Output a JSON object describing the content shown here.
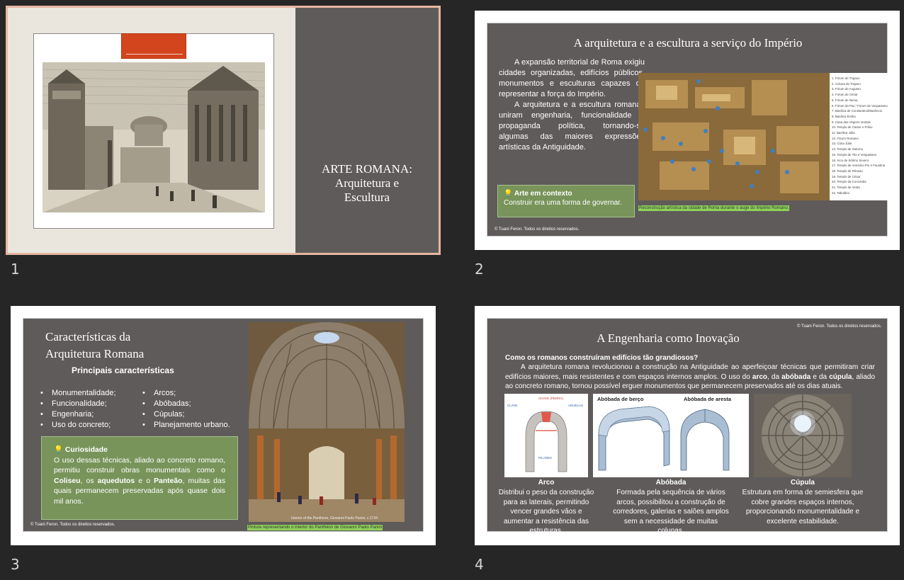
{
  "slide_numbers": [
    "1",
    "2",
    "3",
    "4"
  ],
  "slide1": {
    "title_line1": "ARTE ROMANA:",
    "title_line2": "Arquitetura e",
    "title_line3": "Escultura"
  },
  "slide2": {
    "title": "A arquitetura e a escultura a serviço do Império",
    "para1": "A expansão territorial de Roma exigiu cidades organizadas, edifícios públicos, monumentos e esculturas capazes de representar a força do Império.",
    "para2": "A arquitetura e a escultura romanas uniram engenharia, funcionalidade e propaganda política, tornando-se algumas das maiores expressões artísticas da Antiguidade.",
    "box_title": "Arte em contexto",
    "box_text": "Construir era uma forma de governar.",
    "caption": "Reconstrução artística da cidade de Roma durante o auge do Império Romano.",
    "copyright": "© Tuani Feron. Todos os direitos reservados.",
    "legend": [
      "1. Fórum de Trajano",
      "2. Coluna de Trajano",
      "3. Fórum de Augusto",
      "4. Fórum de César",
      "5. Fórum de Nerva",
      "6. Fórum da Paz / Fórum de Vespasiano",
      "7. Basílica de Constantino/Maxêncio",
      "8. Basílica Emília",
      "9. Casa das Virgens Vestais",
      "10. Templo de Castor e Pólux",
      "11. Basílica Júlia",
      "12. Fórum Romano",
      "13. Cúria Júlia",
      "14. Templo de Saturno",
      "15. Templo de Tito e Vespasiano",
      "16. Arco de Sétimo Severo",
      "17. Templo de Antonino Pio e Faustina",
      "18. Templo de Rômulo",
      "19. Templo de César",
      "20. Templo da Concórdia",
      "21. Templo de Vesta",
      "22. Tabulário"
    ]
  },
  "slide3": {
    "title_line1": "Características da",
    "title_line2": "Arquitetura Romana",
    "subtitle": "Principais características",
    "col1": [
      "Monumentalidade;",
      "Funcionalidade;",
      "Engenharia;",
      "Uso do concreto;"
    ],
    "col2": [
      "Arcos;",
      "Abóbadas;",
      "Cúpulas;",
      "Planejamento urbano."
    ],
    "box_title": "Curiosidade",
    "box_t1": "O uso dessas técnicas, aliado ao concreto romano, permitiu construir obras monumentais como o ",
    "box_b1": "Coliseu",
    "box_t2": ", os ",
    "box_b2": "aquedutos",
    "box_t3": " e o ",
    "box_b3": "Panteão",
    "box_t4": ", muitas das quais permanecem preservadas após quase dois mil anos.",
    "photo_credit": "Interior of the Pantheon, Giovanni Paolo Panini, c.1734",
    "caption": "Pintura representando o interior do Panthéon de Giovanni Paolo Panini",
    "copyright": "© Tuani Feron. Todos os direitos reservados."
  },
  "slide4": {
    "title": "A Engenharia como Inovação",
    "copyright": "© Tuani Feron. Todos os direitos reservados.",
    "question": "Como os romanos construíram edifícios tão grandiosos?",
    "intro_t1": "A arquitetura romana revolucionou a construção na Antiguidade ao aperfeiçoar técnicas que permitiram criar edifícios maiores, mais resistentes e com espaços internos amplos. O uso do ",
    "intro_b1": "arco",
    "intro_t2": ", da ",
    "intro_b2": "abóbada",
    "intro_t3": " e da ",
    "intro_b3": "cúpula",
    "intro_t4": ", aliado ao concreto romano, tornou possível erguer monumentos que permanecem preservados até os dias atuais.",
    "arch_labels": [
      "CHAVE (PEDRA)",
      "CLAVE",
      "ADUELAS",
      "PILARES"
    ],
    "vault_label1": "Abóbada de berço",
    "vault_label2": "Abóbada de aresta",
    "c1_title": "Arco",
    "c1_text": "Distribui o peso da construção para as laterais, permitindo vencer grandes vãos e aumentar a resistência das estruturas.",
    "c2_title": "Abóbada",
    "c2_text": "Formada pela sequência de vários arcos, possibilitou a construção de corredores, galerias e salões amplos sem a necessidade de muitas colunas.",
    "c3_title": "Cúpula",
    "c3_text": "Estrutura em forma de semiesfera que cobre grandes espaços internos, proporcionando monumentalidade e excelente estabilidade."
  }
}
